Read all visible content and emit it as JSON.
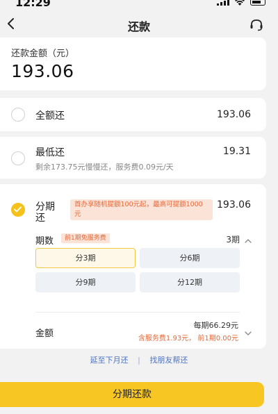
{
  "status_bar": {
    "time": "12:29"
  },
  "nav": {
    "title": "还款"
  },
  "amount_card": {
    "label": "还款金额（元）",
    "value": "193.06"
  },
  "options": {
    "full": {
      "title": "全额还",
      "amount": "193.06"
    },
    "minimum": {
      "title": "最低还",
      "amount": "19.31",
      "subtitle": "剩余173.75元慢慢还，服务费0.09元/天"
    },
    "installment": {
      "title_line1": "分期",
      "title_line2": "还",
      "amount": "193.06",
      "promo": "首办享随机提额100元起，最高可提额1000元"
    }
  },
  "period": {
    "label": "期数",
    "badge": "前1期免服务费",
    "selected_value": "3期",
    "buttons": [
      "分3期",
      "分6期",
      "分9期",
      "分12期"
    ],
    "selected_index": 0
  },
  "amount_row": {
    "label": "金额",
    "per_period": "每期66.29元",
    "fee_note": "含服务费1.93元， 前1期0.00元"
  },
  "links": {
    "defer": "延至下月还",
    "separator": "|",
    "friend": "找朋友帮还"
  },
  "primary_button": {
    "label": "分期还款"
  },
  "colors": {
    "accent": "#f8c623",
    "promo_text": "#e56a3a",
    "promo_bg": "#fbe3d7",
    "link": "#4a72c4"
  }
}
